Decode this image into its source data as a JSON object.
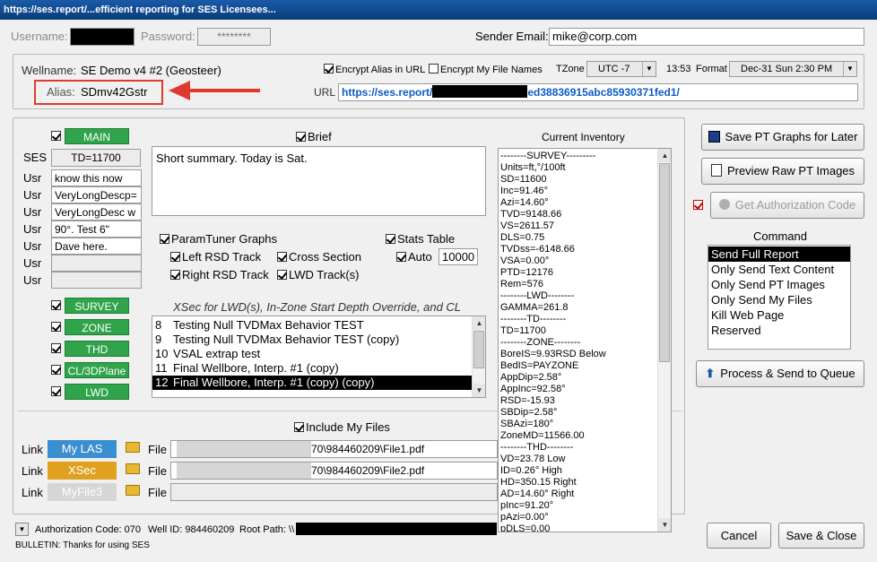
{
  "window": {
    "title": "https://ses.report/...efficient reporting for SES Licensees..."
  },
  "login": {
    "username_label": "Username:",
    "password_label": "Password:",
    "password_value": "********",
    "sender_email_label": "Sender Email:",
    "sender_email_value": "mike@corp.com"
  },
  "well": {
    "wellname_label": "Wellname:",
    "wellname_value": "SE Demo v4 #2 (Geosteer)",
    "alias_label": "Alias:",
    "alias_value": "SDmv42Gstr",
    "encrypt_alias_label": "Encrypt Alias in URL",
    "encrypt_files_label": "Encrypt My File Names",
    "tzone_label": "TZone",
    "tzone_value": "UTC -7",
    "time_value": "13:53",
    "format_label": "Format",
    "format_value": "Dec-31 Sun 2:30 PM",
    "url_label": "URL",
    "url_prefix": "https://ses.report/",
    "url_suffix": "ed38836915abc85930371fed1/"
  },
  "main": {
    "main_label": "MAIN",
    "ses_label": "SES",
    "ses_value": "TD=11700",
    "usr_label": "Usr",
    "usr_values": [
      "know this now",
      "VeryLongDescp=",
      "VeryLongDesc w",
      "90°. Test 6\"",
      "Dave here.",
      "",
      ""
    ],
    "brief_label": "Brief",
    "brief_text": "Short summary. Today is Sat.",
    "paramtuner_label": "ParamTuner Graphs",
    "left_rsd_label": "Left RSD Track",
    "cross_section_label": "Cross Section",
    "right_rsd_label": "Right RSD Track",
    "lwd_tracks_label": "LWD Track(s)",
    "stats_table_label": "Stats Table",
    "auto_label": "Auto",
    "auto_value": "10000",
    "xsec_header": "XSec for LWD(s), In-Zone Start Depth Override, and CL",
    "xsec_rows": [
      {
        "num": "8",
        "text": "Testing Null TVDMax Behavior TEST"
      },
      {
        "num": "9",
        "text": "Testing Null TVDMax Behavior TEST (copy)"
      },
      {
        "num": "10",
        "text": "VSAL extrap test"
      },
      {
        "num": "11",
        "text": "Final Wellbore, Interp. #1 (copy)"
      },
      {
        "num": "12",
        "text": "Final Wellbore, Interp. #1 (copy) (copy)"
      }
    ],
    "side_buttons": [
      "SURVEY",
      "ZONE",
      "THD",
      "CL/3DPlane",
      "LWD"
    ],
    "include_files_label": "Include My Files",
    "link_label": "Link",
    "file_label": "File",
    "links": [
      {
        "name": "My LAS",
        "color": "#3a8fd0",
        "path_mid": "70\\984460209\\File1.pdf"
      },
      {
        "name": "XSec",
        "color": "#e0a020",
        "path_mid": "70\\984460209\\File2.pdf"
      },
      {
        "name": "MyFile3",
        "color": "#d6d6d6",
        "path_mid": ""
      }
    ]
  },
  "inventory": {
    "title": "Current Inventory",
    "lines": [
      "--------SURVEY---------",
      "Units=ft,°/100ft",
      "SD=11600",
      "Inc=91.46°",
      "Azi=14.60°",
      "TVD=9148.66",
      "VS=2611.57",
      "DLS=0.75",
      "TVDss=-6148.66",
      "VSA=0.00°",
      "PTD=12176",
      "Rem=576",
      "--------LWD--------",
      "GAMMA=261.8",
      "--------TD--------",
      "TD=11700",
      "--------ZONE--------",
      "BoreIS=9.93RSD Below",
      "BedIS=PAYZONE",
      "AppDip=2.58°",
      "AppInc=92.58°",
      "RSD=-15.93",
      "SBDip=2.58°",
      "SBAzi=180°",
      "ZoneMD=11566.00",
      "--------THD--------",
      "VD=23.78 Low",
      "ID=0.26° High",
      "HD=350.15 Right",
      "AD=14.60° Right",
      "pInc=91.20°",
      "pAzi=0.00°",
      "pDLS=0.00"
    ]
  },
  "actions": {
    "save_pt": "Save PT Graphs for Later",
    "preview_pt": "Preview Raw PT Images",
    "get_auth": "Get Authorization Code",
    "command_label": "Command",
    "commands": [
      "Send Full Report",
      "Only Send Text Content",
      "Only Send PT Images",
      "Only Send My Files",
      "Kill Web Page",
      "Reserved"
    ],
    "process": "Process & Send to Queue",
    "cancel": "Cancel",
    "save_close": "Save & Close"
  },
  "footer": {
    "auth_label": "Authorization Code: 070",
    "well_id_label": "Well ID: 984460209",
    "root_path_label": "Root Path: \\\\",
    "bulletin": "BULLETIN: Thanks for using SES"
  },
  "colors": {
    "green": "#2fa44a",
    "title": "#0a3d7a",
    "alias_red": "#e03a2f",
    "link_blue": "#0b5cc6"
  }
}
